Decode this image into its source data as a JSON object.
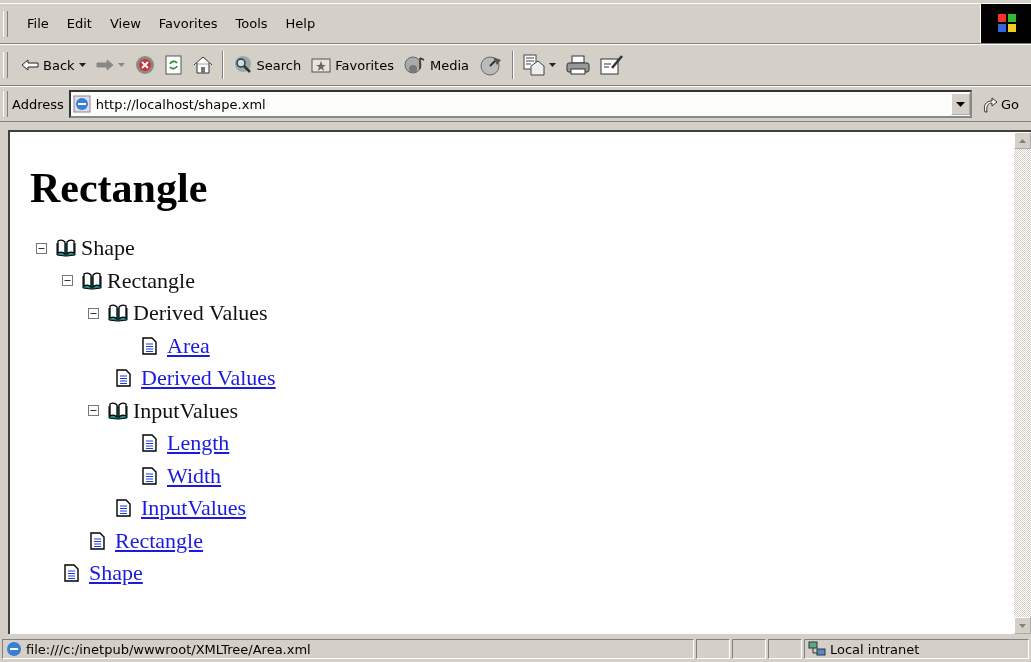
{
  "menu": [
    {
      "label": "File"
    },
    {
      "label": "Edit"
    },
    {
      "label": "View"
    },
    {
      "label": "Favorites"
    },
    {
      "label": "Tools"
    },
    {
      "label": "Help"
    }
  ],
  "toolbar": [
    {
      "kind": "button",
      "label": "Back",
      "dropdown": true,
      "disabled": false
    },
    {
      "kind": "button",
      "dropdown": true,
      "disabled": true
    },
    {
      "kind": "button",
      "disabled": false
    },
    {
      "kind": "button",
      "disabled": false
    },
    {
      "kind": "button",
      "disabled": false
    },
    {
      "kind": "separator"
    },
    {
      "kind": "button",
      "label": "Search",
      "disabled": false
    },
    {
      "kind": "button",
      "label": "Favorites",
      "disabled": false
    },
    {
      "kind": "button",
      "label": "Media",
      "disabled": false
    },
    {
      "kind": "button",
      "disabled": false
    },
    {
      "kind": "separator"
    },
    {
      "kind": "button",
      "dropdown": true,
      "disabled": false
    },
    {
      "kind": "button",
      "disabled": false
    },
    {
      "kind": "button",
      "disabled": false
    }
  ],
  "address": {
    "label": "Address",
    "value": "http://localhost/shape.xml",
    "go": "Go"
  },
  "page": {
    "heading": "Rectangle",
    "tree": [
      {
        "kind": "folder",
        "label": "Shape",
        "expanded": true,
        "link": "Shape",
        "children": [
          {
            "kind": "folder",
            "label": "Rectangle",
            "expanded": true,
            "link": "Rectangle",
            "children": [
              {
                "kind": "folder",
                "label": "Derived Values",
                "expanded": true,
                "link": "Derived Values",
                "children": [
                  {
                    "kind": "leaf",
                    "label": "Area"
                  }
                ]
              },
              {
                "kind": "folder",
                "label": "InputValues",
                "expanded": true,
                "link": "InputValues",
                "children": [
                  {
                    "kind": "leaf",
                    "label": "Length"
                  },
                  {
                    "kind": "leaf",
                    "label": "Width"
                  }
                ]
              }
            ]
          }
        ]
      }
    ]
  },
  "status_bar": {
    "text": "file:///c:/inetpub/wwwroot/XMLTree/Area.xml",
    "zone": "Local intranet"
  }
}
